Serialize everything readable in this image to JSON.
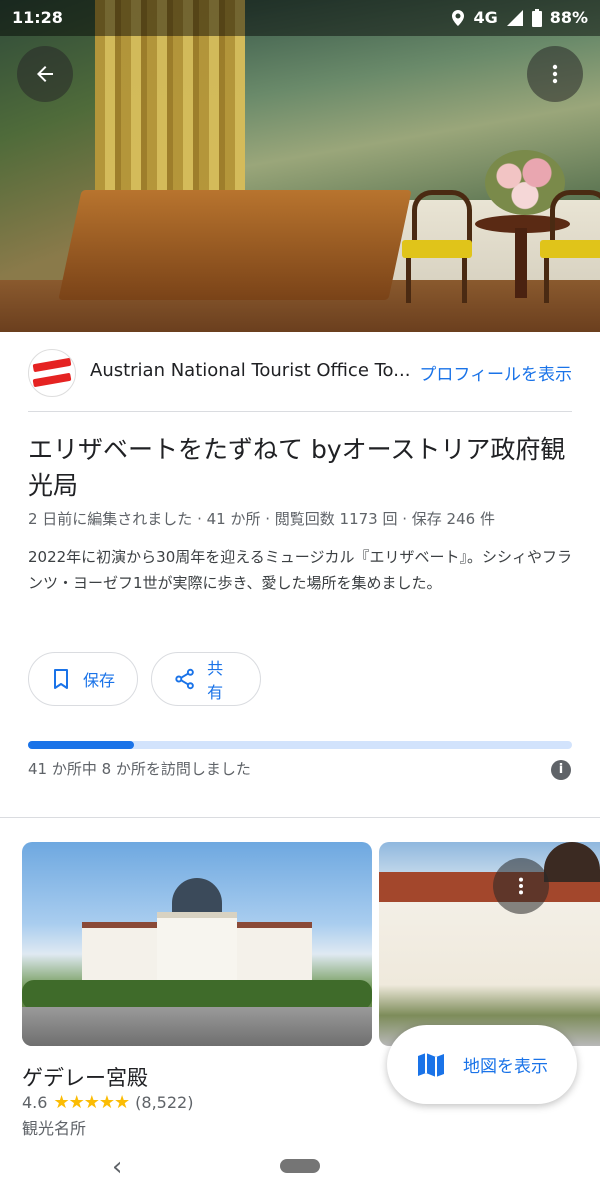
{
  "status_bar": {
    "time": "11:28",
    "network": "4G",
    "battery": "88%"
  },
  "profile": {
    "name": "Austrian National Tourist Office To...",
    "view_profile": "プロフィールを表示"
  },
  "list": {
    "title": "エリザベートをたずねて byオーストリア政府観光局",
    "meta": "2 日前に編集されました · 41 か所 · 閲覧回数 1173 回 · 保存 246 件",
    "description": "2022年に初演から30周年を迎えるミュージカル『エリザベート』。シシィやフランツ・ヨーゼフ1世が実際に歩き、愛した場所を集めました。"
  },
  "actions": {
    "save_label": "保存",
    "share_label": "共有"
  },
  "progress": {
    "text": "41 か所中 8 か所を訪問しました",
    "visited": 8,
    "total": 41
  },
  "places": [
    {
      "name": "ゲデレー宮殿",
      "rating": "4.6",
      "stars": "★★★★★",
      "reviews": "(8,522)",
      "category": "観光名所"
    }
  ],
  "map_button": {
    "label": "地図を表示"
  },
  "colors": {
    "accent": "#1a73e8",
    "star": "#fbbc04",
    "logo_red": "#e52322"
  }
}
